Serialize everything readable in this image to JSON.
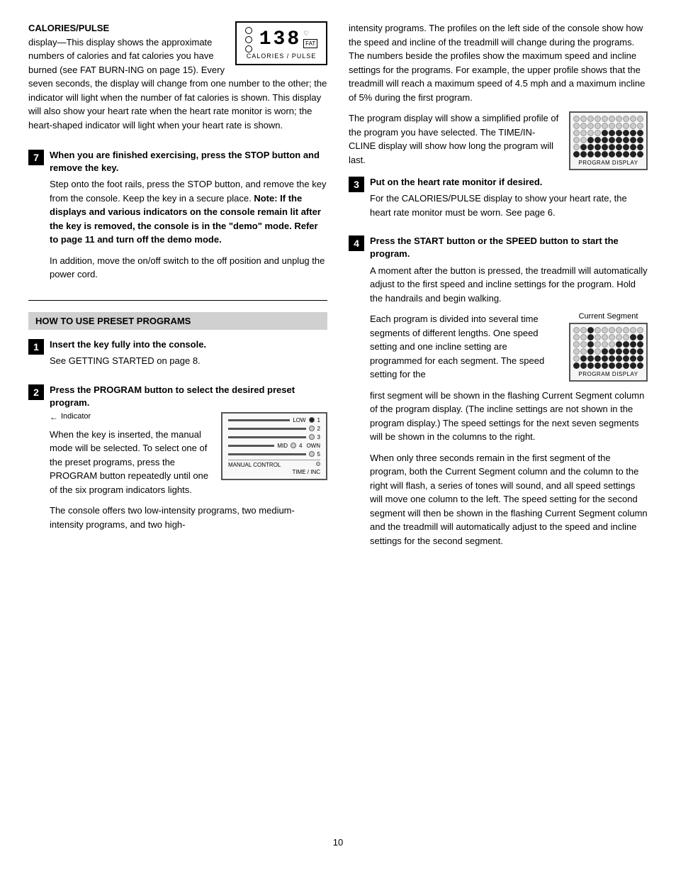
{
  "page": {
    "number": "10"
  },
  "left": {
    "calories_pulse_bold": "CALORIES/PULSE",
    "calories_pulse_display_label": "CALORIES / PULSE",
    "calories_display_number": "138",
    "calories_body_1": "display—This display shows the approximate numbers of calories and fat calories you have burned (see FAT BURN-ING on page 15). Every seven seconds, the display will change from one number to the other; the indicator will light when the number of fat calories is shown. This display will also show your heart rate when the heart rate monitor is worn; the heart-shaped indicator will light when your heart rate is shown.",
    "step7_title": "When you are finished exercising, press the STOP button and remove the key.",
    "step7_body_1": "Step onto the foot rails, press the STOP button, and remove the key from the console. Keep the key in a secure place.",
    "step7_body_note": "Note: If the displays and various indicators on the console remain lit after the key is removed, the console is in the \"demo\" mode. Refer to page 11 and turn off the demo mode.",
    "step7_body_2": "In addition, move the on/off switch to the off position and unplug the power cord.",
    "section_header": "HOW TO USE PRESET PROGRAMS",
    "step1_title": "Insert the key fully into the console.",
    "step1_body": "See GETTING STARTED on page 8.",
    "step2_title": "Press the PROGRAM button to select the desired preset program.",
    "step2_body_1": "When the key is inserted, the manual mode will be selected. To select one of the preset programs, press the PROGRAM button repeatedly until one of the six program indicators lights.",
    "indicator_label": "Indicator",
    "step2_body_2": "The console offers two low-intensity programs, two medium-intensity programs, and two high-"
  },
  "right": {
    "body_1": "intensity programs. The profiles on the left side of the console show how the speed and incline of the treadmill will change during the programs. The numbers beside the profiles show the maximum speed and incline settings for the programs. For example, the upper profile shows that the treadmill will reach a maximum speed of 4.5 mph and a maximum incline of 5% during the first program.",
    "body_2": "The program display will show a simplified profile of the program you have selected. The TIME/IN-CLINE display will show how long the program will last.",
    "prog_display_label": "PROGRAM DISPLAY",
    "step3_title": "Put on the heart rate monitor if desired.",
    "step3_body": "For the CALORIES/PULSE display to show your heart rate, the heart rate monitor must be worn. See page 6.",
    "step4_title": "Press the START button or the SPEED      button to start the program.",
    "step4_body_1": "A moment after the button is pressed, the treadmill will automatically adjust to the first speed and incline settings for the program. Hold the handrails and begin walking.",
    "current_segment_label": "Current Segment",
    "step4_body_2": "Each program is divided into several time segments of different lengths. One speed setting and one incline setting are programmed for each segment. The speed setting for the",
    "prog_display_label_2": "PROGRAM DISPLAY",
    "body_3": "first segment will be shown in the flashing Current Segment column of the program display. (The incline settings are not shown in the program display.) The speed settings for the next seven segments will be shown in the columns to the right.",
    "body_4": "When only three seconds remain in the first segment of the program, both the Current Segment column and the column to the right will flash, a series of tones will sound, and all speed settings will move one column to the left. The speed setting for the second segment will then be shown in the flashing Current Segment column and the treadmill will automatically adjust to the speed and incline settings for the second segment."
  }
}
